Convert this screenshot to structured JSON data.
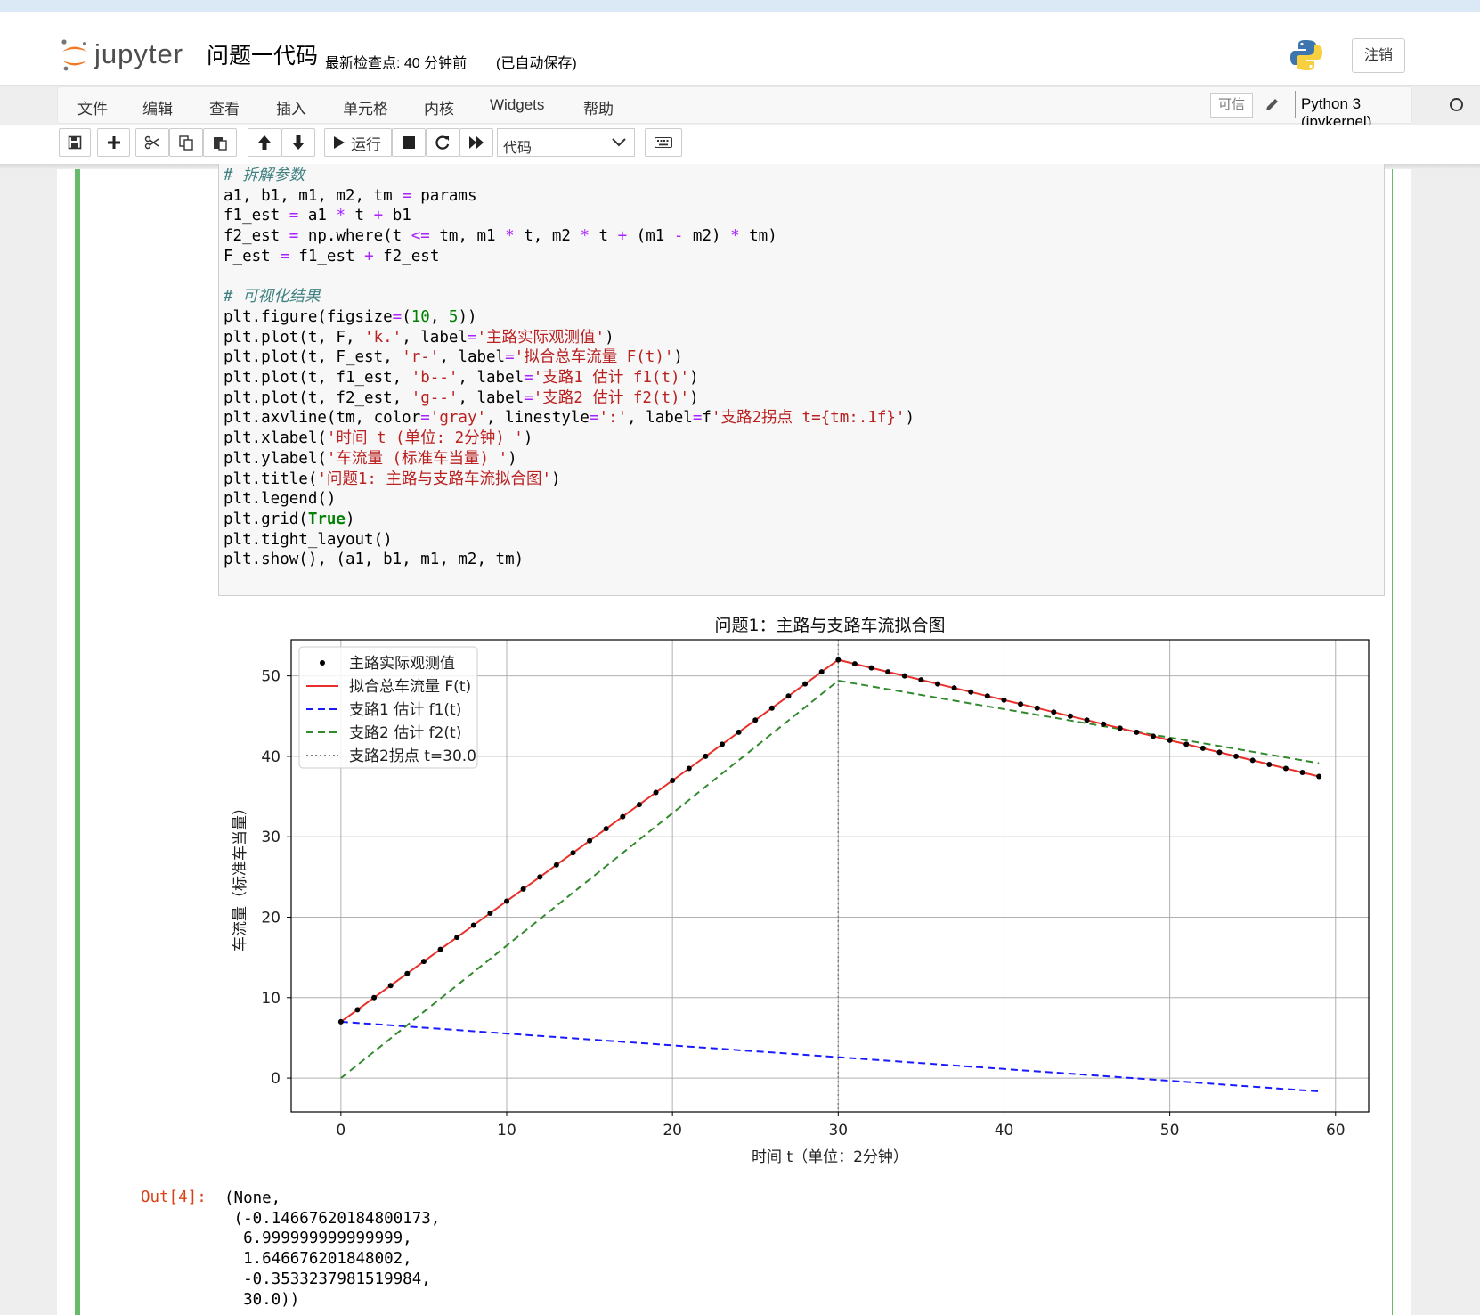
{
  "header": {
    "logo_text": "jupyter",
    "notebook_name": "问题一代码",
    "checkpoint": "最新检查点: 40 分钟前",
    "autosave": "(已自动保存)",
    "logout": "注销"
  },
  "menu": {
    "items": [
      "文件",
      "编辑",
      "查看",
      "插入",
      "单元格",
      "内核",
      "Widgets",
      "帮助"
    ],
    "trusted": "可信",
    "kernel": "Python 3 (ipykernel)"
  },
  "toolbar": {
    "run_label": "运行",
    "cell_type": "代码"
  },
  "code": {
    "lines": [
      "# 拆解参数",
      "a1, b1, m1, m2, tm = params",
      "f1_est = a1 * t + b1",
      "f2_est = np.where(t <= tm, m1 * t, m2 * t + (m1 - m2) * tm)",
      "F_est = f1_est + f2_est",
      "",
      "# 可视化结果",
      "plt.figure(figsize=(10, 5))",
      "plt.plot(t, F, 'k.', label='主路实际观测值')",
      "plt.plot(t, F_est, 'r-', label='拟合总车流量 F(t)')",
      "plt.plot(t, f1_est, 'b--', label='支路1 估计 f1(t)')",
      "plt.plot(t, f2_est, 'g--', label='支路2 估计 f2(t)')",
      "plt.axvline(tm, color='gray', linestyle=':', label=f'支路2拐点 t={tm:.1f}')",
      "plt.xlabel('时间 t (单位: 2分钟) ')",
      "plt.ylabel('车流量 (标准车当量) ')",
      "plt.title('问题1: 主路与支路车流拟合图')",
      "plt.legend()",
      "plt.grid(True)",
      "plt.tight_layout()",
      "plt.show(), (a1, b1, m1, m2, tm)"
    ]
  },
  "output": {
    "prompt": "Out[4]:",
    "text": "(None,\n (-0.14667620184800173,\n  6.999999999999999,\n  1.646676201848002,\n  -0.3533237981519984,\n  30.0))"
  },
  "chart_data": {
    "type": "line",
    "title": "问题1：主路与支路车流拟合图",
    "xlabel": "时间 t（单位：2分钟）",
    "ylabel": "车流量（标准车当量）",
    "xlim": [
      -3,
      62
    ],
    "ylim": [
      -4.2,
      54.5
    ],
    "xticks": [
      0,
      10,
      20,
      30,
      40,
      50,
      60
    ],
    "yticks": [
      0,
      10,
      20,
      30,
      40,
      50
    ],
    "grid": true,
    "legend_position": "top-left",
    "params": {
      "a1": -0.14667620184800173,
      "b1": 6.999999999999999,
      "m1": 1.646676201848002,
      "m2": -0.3533237981519984,
      "tm": 30.0
    },
    "x_range": [
      0,
      59
    ],
    "series": [
      {
        "name": "主路实际观测值",
        "style": "points",
        "color": "#000000"
      },
      {
        "name": "拟合总车流量 F(t)",
        "style": "solid",
        "color": "#e8302a"
      },
      {
        "name": "支路1 估计 f1(t)",
        "style": "dashed",
        "color": "#1a1aff"
      },
      {
        "name": "支路2 估计 f2(t)",
        "style": "dashed",
        "color": "#338a2e"
      },
      {
        "name": "支路2拐点 t=30.0",
        "style": "dotted",
        "color": "#808080"
      }
    ]
  }
}
